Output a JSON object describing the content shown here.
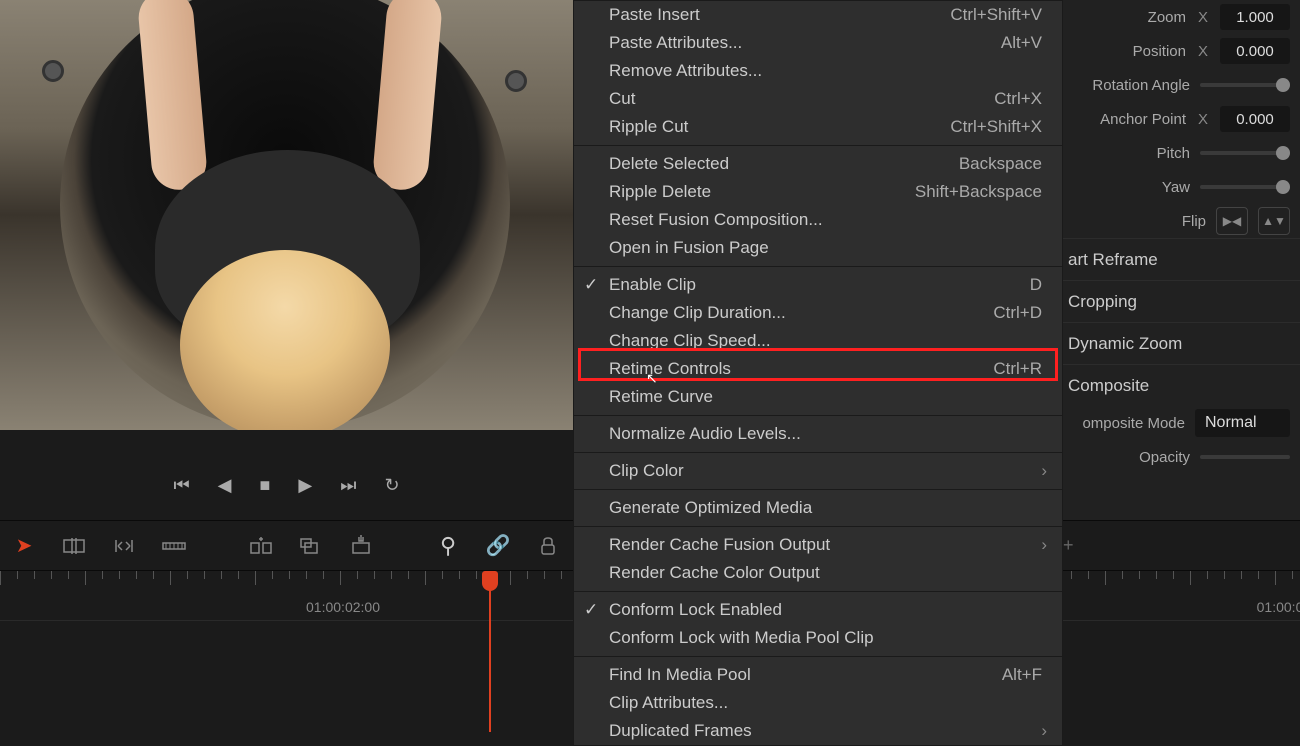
{
  "playback": {
    "first": "⏮",
    "prev": "◀",
    "stop": "■",
    "play": "▶",
    "last": "⏭",
    "loop": "↻"
  },
  "timeline": {
    "timecode_left": "01:00:02:00",
    "timecode_right": "01:00:0"
  },
  "contextMenu": {
    "items": [
      {
        "label": "Paste Insert",
        "shortcut": "Ctrl+Shift+V"
      },
      {
        "label": "Paste Attributes...",
        "shortcut": "Alt+V"
      },
      {
        "label": "Remove Attributes..."
      },
      {
        "label": "Cut",
        "shortcut": "Ctrl+X"
      },
      {
        "label": "Ripple Cut",
        "shortcut": "Ctrl+Shift+X"
      },
      {
        "sep": true
      },
      {
        "label": "Delete Selected",
        "shortcut": "Backspace"
      },
      {
        "label": "Ripple Delete",
        "shortcut": "Shift+Backspace"
      },
      {
        "label": "Reset Fusion Composition..."
      },
      {
        "label": "Open in Fusion Page"
      },
      {
        "sep": true
      },
      {
        "label": "Enable Clip",
        "shortcut": "D",
        "check": true
      },
      {
        "label": "Change Clip Duration...",
        "shortcut": "Ctrl+D"
      },
      {
        "label": "Change Clip Speed..."
      },
      {
        "label": "Retime Controls",
        "shortcut": "Ctrl+R",
        "highlight": true
      },
      {
        "label": "Retime Curve"
      },
      {
        "sep": true
      },
      {
        "label": "Normalize Audio Levels..."
      },
      {
        "sep": true
      },
      {
        "label": "Clip Color",
        "submenu": true
      },
      {
        "sep": true
      },
      {
        "label": "Generate Optimized Media"
      },
      {
        "sep": true
      },
      {
        "label": "Render Cache Fusion Output",
        "submenu": true
      },
      {
        "label": "Render Cache Color Output"
      },
      {
        "sep": true
      },
      {
        "label": "Conform Lock Enabled",
        "check": true
      },
      {
        "label": "Conform Lock with Media Pool Clip"
      },
      {
        "sep": true
      },
      {
        "label": "Find In Media Pool",
        "shortcut": "Alt+F"
      },
      {
        "label": "Clip Attributes..."
      },
      {
        "label": "Duplicated Frames",
        "submenu": true
      }
    ]
  },
  "inspector": {
    "zoom_label": "Zoom",
    "zoom_axis": "X",
    "zoom_val": "1.000",
    "position_label": "Position",
    "position_axis": "X",
    "position_val": "0.000",
    "rotation_label": "Rotation Angle",
    "anchor_label": "Anchor Point",
    "anchor_axis": "X",
    "anchor_val": "0.000",
    "pitch_label": "Pitch",
    "yaw_label": "Yaw",
    "flip_label": "Flip",
    "sections": {
      "reframe": "art Reframe",
      "cropping": "Cropping",
      "dzoom": "Dynamic Zoom",
      "composite": "Composite"
    },
    "compmode_label": "omposite Mode",
    "compmode_val": "Normal",
    "opacity_label": "Opacity"
  }
}
